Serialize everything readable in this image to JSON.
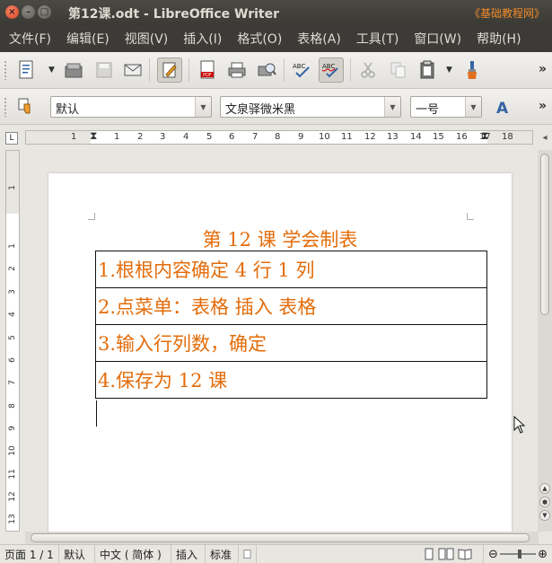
{
  "window": {
    "title": "第12课.odt - LibreOffice Writer",
    "tag": "《基础教程网》"
  },
  "menu": [
    "文件(F)",
    "编辑(E)",
    "视图(V)",
    "插入(I)",
    "格式(O)",
    "表格(A)",
    "工具(T)",
    "窗口(W)",
    "帮助(H)"
  ],
  "format_bar": {
    "style": "默认",
    "font": "文泉驿微米黑",
    "size": "一号"
  },
  "ruler": {
    "h_labels": [
      "1",
      "1",
      "2",
      "3",
      "4",
      "5",
      "6",
      "7",
      "8",
      "9",
      "10",
      "11",
      "12",
      "13",
      "14",
      "15",
      "16",
      "17",
      "18"
    ],
    "v_labels": [
      "1",
      "1",
      "2",
      "3",
      "4",
      "5",
      "6",
      "7",
      "8",
      "9",
      "10",
      "11",
      "12",
      "13"
    ]
  },
  "document": {
    "title": "第 12 课 学会制表",
    "rows": [
      "1.根根内容确定 4 行 1 列",
      "2.点菜单：表格 插入 表格",
      "3.输入行列数，确定",
      "4.保存为 12 课"
    ],
    "text_color": "#e36c0a"
  },
  "status": {
    "page": "页面 1 / 1",
    "style": "默认",
    "language": "中文 ( 简体 )",
    "mode": "插入",
    "selection": "标准"
  },
  "colors": {
    "titlebar": "#3c3b37",
    "close_button": "#e05a2b",
    "accent_tag": "#f08a2a"
  }
}
